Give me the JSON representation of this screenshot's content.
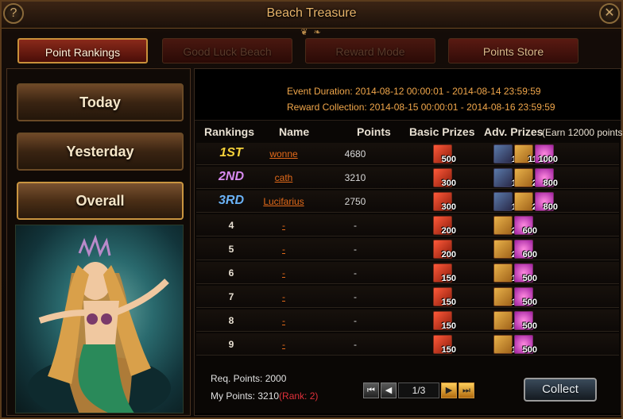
{
  "window": {
    "title": "Beach Treasure",
    "help_glyph": "?",
    "close_glyph": "✕",
    "ornament": "❦ ❧"
  },
  "tabs": [
    {
      "label": "Point Rankings",
      "active": true
    },
    {
      "label": "Good Luck Beach",
      "active": false
    },
    {
      "label": "Reward Mode",
      "active": false
    },
    {
      "label": "Points Store",
      "active": false
    }
  ],
  "sidebar": {
    "buttons": [
      {
        "label": "Today"
      },
      {
        "label": "Yesterday"
      },
      {
        "label": "Overall",
        "active": true
      }
    ]
  },
  "event": {
    "duration": "Event Duration: 2014-08-12 00:00:01 - 2014-08-14 23:59:59",
    "collection": "Reward Collection: 2014-08-15 00:00:01 - 2014-08-16 23:59:59"
  },
  "table": {
    "headers": {
      "rankings": "Rankings",
      "name": "Name",
      "points": "Points",
      "basic": "Basic Prizes",
      "adv": "Adv. Prizes",
      "earn": "(Earn 12000 points"
    },
    "rows": [
      {
        "rank": "1ST",
        "rank_color": "#f6d23a",
        "name": "wonne",
        "points": "4680",
        "basic": "500",
        "adv": [
          "1",
          "11",
          "1000"
        ]
      },
      {
        "rank": "2ND",
        "rank_color": "#d88af0",
        "name": "cath",
        "points": "3210",
        "basic": "300",
        "adv": [
          "1",
          "2",
          "800"
        ]
      },
      {
        "rank": "3RD",
        "rank_color": "#6ab2f6",
        "name": "Lucifarius",
        "points": "2750",
        "basic": "300",
        "adv": [
          "1",
          "2",
          "800"
        ]
      },
      {
        "rank": "4",
        "name": "-",
        "points": "-",
        "basic": "200",
        "adv": [
          "2",
          "600"
        ]
      },
      {
        "rank": "5",
        "name": "-",
        "points": "-",
        "basic": "200",
        "adv": [
          "2",
          "600"
        ]
      },
      {
        "rank": "6",
        "name": "-",
        "points": "-",
        "basic": "150",
        "adv": [
          "1",
          "500"
        ]
      },
      {
        "rank": "7",
        "name": "-",
        "points": "-",
        "basic": "150",
        "adv": [
          "1",
          "500"
        ]
      },
      {
        "rank": "8",
        "name": "-",
        "points": "-",
        "basic": "150",
        "adv": [
          "1",
          "500"
        ]
      },
      {
        "rank": "9",
        "name": "-",
        "points": "-",
        "basic": "150",
        "adv": [
          "1",
          "500"
        ]
      }
    ]
  },
  "footer": {
    "req_points": "Req. Points: 2000",
    "my_points": "My Points: 3210",
    "rank_note": "(Rank: 2)",
    "page": "1/3",
    "first_glyph": "⏮",
    "prev_glyph": "◀",
    "next_glyph": "▶",
    "last_glyph": "⏭",
    "collect_label": "Collect"
  }
}
